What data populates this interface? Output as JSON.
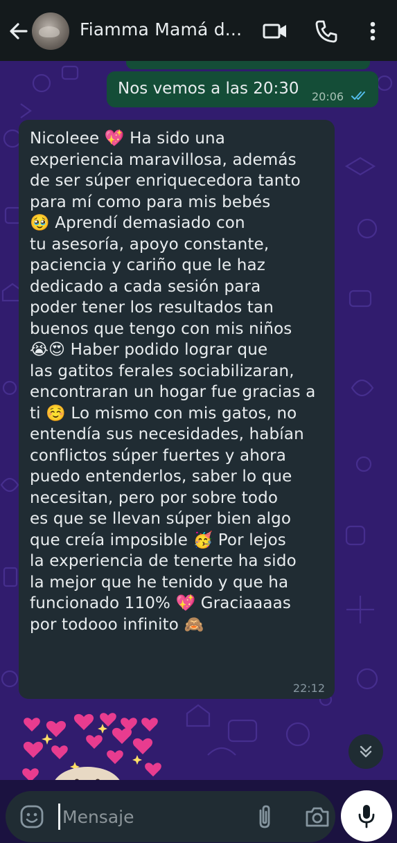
{
  "header": {
    "title": "Fiamma Mamá d..."
  },
  "messages": {
    "outgoing": {
      "text": "Nos vemos a las 20:30",
      "time": "20:06"
    },
    "incoming": {
      "text": "Nicoleee 💖 Ha sido una\nexperiencia maravillosa, además\nde ser súper enriquecedora tanto\npara mí como para mis bebés\n🥹 Aprendí demasiado con\ntu asesoría, apoyo constante,\npaciencia y cariño que le haz\ndedicado a cada sesión para\npoder tener los resultados tan\nbuenos que tengo con mis niños\n😭😍 Haber podido lograr que\nlas gatitos ferales sociabilizaran,\nencontraran un hogar fue gracias a\nti ☺️ Lo mismo con mis gatos, no\nentendía sus necesidades, habían\nconflictos súper  fuertes y ahora\npuedo entenderlos, saber lo que\nnecesitan, pero por sobre todo\nes que se llevan súper bien algo\nque creía imposible 🥳 Por lejos\nla experiencia de tenerte ha sido\nla mejor que he tenido y que ha\nfuncionado 110% 💖 Graciaaaas\npor todooo infinito 🙈",
      "time": "22:12"
    }
  },
  "composer": {
    "placeholder": "Mensaje"
  },
  "icons": {
    "back": "arrow-left-icon",
    "video": "video-call-icon",
    "phone": "phone-icon",
    "menu": "more-vertical-icon",
    "emoji": "emoji-icon",
    "attach": "paperclip-icon",
    "camera": "camera-icon",
    "mic": "mic-icon",
    "scroll": "double-chevron-down-icon"
  },
  "colors": {
    "header_bg": "#141a1c",
    "wallpaper": "#311c6e",
    "outgoing_bubble": "#144d37",
    "incoming_bubble": "#202c33",
    "read_ticks": "#53bdeb"
  }
}
